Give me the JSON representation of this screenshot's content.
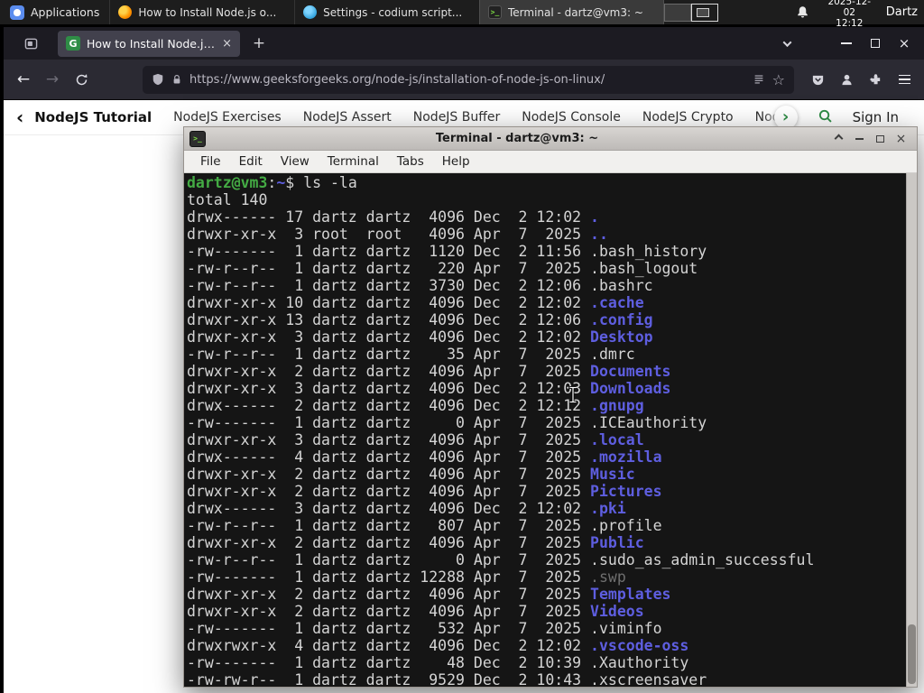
{
  "panel": {
    "applications_label": "Applications",
    "tasks": [
      {
        "title": "How to Install Node.js o...",
        "icon": "firefox-icon"
      },
      {
        "title": "Settings - codium script...",
        "icon": "codium-icon"
      },
      {
        "title": "Terminal - dartz@vm3: ~",
        "icon": "terminal-icon"
      }
    ],
    "clock": {
      "date": "2025-12-02",
      "time": "12:12"
    },
    "user": "Dartz"
  },
  "browser": {
    "tab_title": "How to Install Node.js on...",
    "url": "https://www.geeksforgeeks.org/node-js/installation-of-node-js-on-linux/",
    "site_nav": {
      "primary": "NodeJS Tutorial",
      "links": [
        "NodeJS Exercises",
        "NodeJS Assert",
        "NodeJS Buffer",
        "NodeJS Console",
        "NodeJS Crypto",
        "NodeJS DNS",
        "Node"
      ],
      "sign_in": "Sign In"
    }
  },
  "terminal": {
    "window_title": "Terminal - dartz@vm3: ~",
    "menu": [
      "File",
      "Edit",
      "View",
      "Terminal",
      "Tabs",
      "Help"
    ],
    "prompt_user": "dartz@vm3",
    "prompt_sep": ":",
    "prompt_path": "~",
    "prompt_symbol": "$",
    "command": "ls -la",
    "total_line": "total 140",
    "listing": [
      {
        "perms": "drwx------",
        "links": 17,
        "owner": "dartz",
        "group": "dartz",
        "size": 4096,
        "month": "Dec",
        "day": 2,
        "time": "12:02",
        "name": ".",
        "type": "dir"
      },
      {
        "perms": "drwxr-xr-x",
        "links": 3,
        "owner": "root",
        "group": "root",
        "size": 4096,
        "month": "Apr",
        "day": 7,
        "time": "2025",
        "name": "..",
        "type": "dir"
      },
      {
        "perms": "-rw-------",
        "links": 1,
        "owner": "dartz",
        "group": "dartz",
        "size": 1120,
        "month": "Dec",
        "day": 2,
        "time": "11:56",
        "name": ".bash_history",
        "type": "file"
      },
      {
        "perms": "-rw-r--r--",
        "links": 1,
        "owner": "dartz",
        "group": "dartz",
        "size": 220,
        "month": "Apr",
        "day": 7,
        "time": "2025",
        "name": ".bash_logout",
        "type": "file"
      },
      {
        "perms": "-rw-r--r--",
        "links": 1,
        "owner": "dartz",
        "group": "dartz",
        "size": 3730,
        "month": "Dec",
        "day": 2,
        "time": "12:06",
        "name": ".bashrc",
        "type": "file"
      },
      {
        "perms": "drwxr-xr-x",
        "links": 10,
        "owner": "dartz",
        "group": "dartz",
        "size": 4096,
        "month": "Dec",
        "day": 2,
        "time": "12:02",
        "name": ".cache",
        "type": "dir"
      },
      {
        "perms": "drwxr-xr-x",
        "links": 13,
        "owner": "dartz",
        "group": "dartz",
        "size": 4096,
        "month": "Dec",
        "day": 2,
        "time": "12:06",
        "name": ".config",
        "type": "dir"
      },
      {
        "perms": "drwxr-xr-x",
        "links": 3,
        "owner": "dartz",
        "group": "dartz",
        "size": 4096,
        "month": "Dec",
        "day": 2,
        "time": "12:02",
        "name": "Desktop",
        "type": "dir"
      },
      {
        "perms": "-rw-r--r--",
        "links": 1,
        "owner": "dartz",
        "group": "dartz",
        "size": 35,
        "month": "Apr",
        "day": 7,
        "time": "2025",
        "name": ".dmrc",
        "type": "file"
      },
      {
        "perms": "drwxr-xr-x",
        "links": 2,
        "owner": "dartz",
        "group": "dartz",
        "size": 4096,
        "month": "Apr",
        "day": 7,
        "time": "2025",
        "name": "Documents",
        "type": "dir"
      },
      {
        "perms": "drwxr-xr-x",
        "links": 3,
        "owner": "dartz",
        "group": "dartz",
        "size": 4096,
        "month": "Dec",
        "day": 2,
        "time": "12:03",
        "name": "Downloads",
        "type": "dir"
      },
      {
        "perms": "drwx------",
        "links": 2,
        "owner": "dartz",
        "group": "dartz",
        "size": 4096,
        "month": "Dec",
        "day": 2,
        "time": "12:12",
        "name": ".gnupg",
        "type": "dir"
      },
      {
        "perms": "-rw-------",
        "links": 1,
        "owner": "dartz",
        "group": "dartz",
        "size": 0,
        "month": "Apr",
        "day": 7,
        "time": "2025",
        "name": ".ICEauthority",
        "type": "file"
      },
      {
        "perms": "drwxr-xr-x",
        "links": 3,
        "owner": "dartz",
        "group": "dartz",
        "size": 4096,
        "month": "Apr",
        "day": 7,
        "time": "2025",
        "name": ".local",
        "type": "dir"
      },
      {
        "perms": "drwx------",
        "links": 4,
        "owner": "dartz",
        "group": "dartz",
        "size": 4096,
        "month": "Apr",
        "day": 7,
        "time": "2025",
        "name": ".mozilla",
        "type": "dir"
      },
      {
        "perms": "drwxr-xr-x",
        "links": 2,
        "owner": "dartz",
        "group": "dartz",
        "size": 4096,
        "month": "Apr",
        "day": 7,
        "time": "2025",
        "name": "Music",
        "type": "dir"
      },
      {
        "perms": "drwxr-xr-x",
        "links": 2,
        "owner": "dartz",
        "group": "dartz",
        "size": 4096,
        "month": "Apr",
        "day": 7,
        "time": "2025",
        "name": "Pictures",
        "type": "dir"
      },
      {
        "perms": "drwx------",
        "links": 3,
        "owner": "dartz",
        "group": "dartz",
        "size": 4096,
        "month": "Dec",
        "day": 2,
        "time": "12:02",
        "name": ".pki",
        "type": "dir"
      },
      {
        "perms": "-rw-r--r--",
        "links": 1,
        "owner": "dartz",
        "group": "dartz",
        "size": 807,
        "month": "Apr",
        "day": 7,
        "time": "2025",
        "name": ".profile",
        "type": "file"
      },
      {
        "perms": "drwxr-xr-x",
        "links": 2,
        "owner": "dartz",
        "group": "dartz",
        "size": 4096,
        "month": "Apr",
        "day": 7,
        "time": "2025",
        "name": "Public",
        "type": "dir"
      },
      {
        "perms": "-rw-r--r--",
        "links": 1,
        "owner": "dartz",
        "group": "dartz",
        "size": 0,
        "month": "Apr",
        "day": 7,
        "time": "2025",
        "name": ".sudo_as_admin_successful",
        "type": "file"
      },
      {
        "perms": "-rw-------",
        "links": 1,
        "owner": "dartz",
        "group": "dartz",
        "size": 12288,
        "month": "Apr",
        "day": 7,
        "time": "2025",
        "name": ".swp",
        "type": "dim"
      },
      {
        "perms": "drwxr-xr-x",
        "links": 2,
        "owner": "dartz",
        "group": "dartz",
        "size": 4096,
        "month": "Apr",
        "day": 7,
        "time": "2025",
        "name": "Templates",
        "type": "dir"
      },
      {
        "perms": "drwxr-xr-x",
        "links": 2,
        "owner": "dartz",
        "group": "dartz",
        "size": 4096,
        "month": "Apr",
        "day": 7,
        "time": "2025",
        "name": "Videos",
        "type": "dir"
      },
      {
        "perms": "-rw-------",
        "links": 1,
        "owner": "dartz",
        "group": "dartz",
        "size": 532,
        "month": "Apr",
        "day": 7,
        "time": "2025",
        "name": ".viminfo",
        "type": "file"
      },
      {
        "perms": "drwxrwxr-x",
        "links": 4,
        "owner": "dartz",
        "group": "dartz",
        "size": 4096,
        "month": "Dec",
        "day": 2,
        "time": "12:02",
        "name": ".vscode-oss",
        "type": "dir"
      },
      {
        "perms": "-rw-------",
        "links": 1,
        "owner": "dartz",
        "group": "dartz",
        "size": 48,
        "month": "Dec",
        "day": 2,
        "time": "10:39",
        "name": ".Xauthority",
        "type": "file"
      },
      {
        "perms": "-rw-rw-r--",
        "links": 1,
        "owner": "dartz",
        "group": "dartz",
        "size": 9529,
        "month": "Dec",
        "day": 2,
        "time": "10:43",
        "name": ".xscreensaver",
        "type": "file"
      }
    ]
  },
  "glyphs": {
    "close": "×",
    "plus": "+",
    "back": "←",
    "forward": "→",
    "star": "☆",
    "back_chevron": "‹",
    "next_chevron": "›",
    "favicon_letter": "G",
    "term_glyph": ">_"
  },
  "colors": {
    "gfg_green": "#2f8d46",
    "term_dir_blue": "#5e5ee0",
    "term_prompt_green": "#44ab44"
  }
}
